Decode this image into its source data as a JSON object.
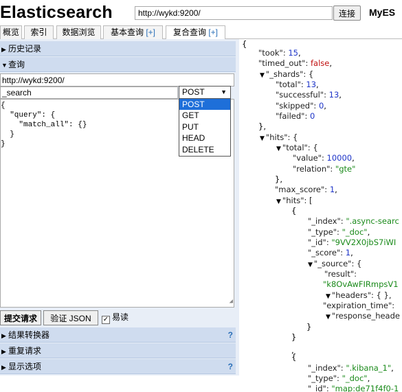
{
  "header": {
    "title": "Elasticsearch",
    "url_value": "http://wykd:9200/",
    "connect_label": "连接",
    "cluster_name": "MyES"
  },
  "tabs": [
    {
      "label": "概览"
    },
    {
      "label": "索引"
    },
    {
      "label": "数据浏览"
    },
    {
      "label": "基本查询",
      "plus": "[+]"
    },
    {
      "label": "复合查询",
      "plus": "[+]"
    }
  ],
  "sections": {
    "history": "历史记录",
    "query": "查询",
    "result_transformer": "结果转换器",
    "repeat_request": "重复请求",
    "display_options": "显示选项",
    "help": "?"
  },
  "query": {
    "path_value": "http://wykd:9200/",
    "endpoint_value": "_search",
    "method_selected": "POST",
    "method_options": [
      "POST",
      "GET",
      "PUT",
      "HEAD",
      "DELETE"
    ],
    "body_lines": [
      "{",
      "  \"query\": {",
      "    \"match_all\": {}",
      "  }",
      "}"
    ],
    "submit_label": "提交请求",
    "validate_label": "验证 JSON",
    "easy_read_label": "易读",
    "easy_read_checked": true
  },
  "response": {
    "took": "15",
    "timed_out": "false",
    "shards_total": "13",
    "shards_successful": "13",
    "shards_skipped": "0",
    "shards_failed": "0",
    "hits_total_value": "10000",
    "hits_total_relation": "\"gte\"",
    "max_score": "1",
    "hit1_index": "\".async-searc",
    "hit1_type": "\"_doc\"",
    "hit1_id": "\"9VV2X0jbS7iWI",
    "hit1_score": "1",
    "hit1_result": "\"k8OvAwFIRmpsV1",
    "hit2_index": "\".kibana_1\"",
    "hit2_type": "\"_doc\"",
    "hit2_id": "\"map:de71f4f0-1"
  }
}
